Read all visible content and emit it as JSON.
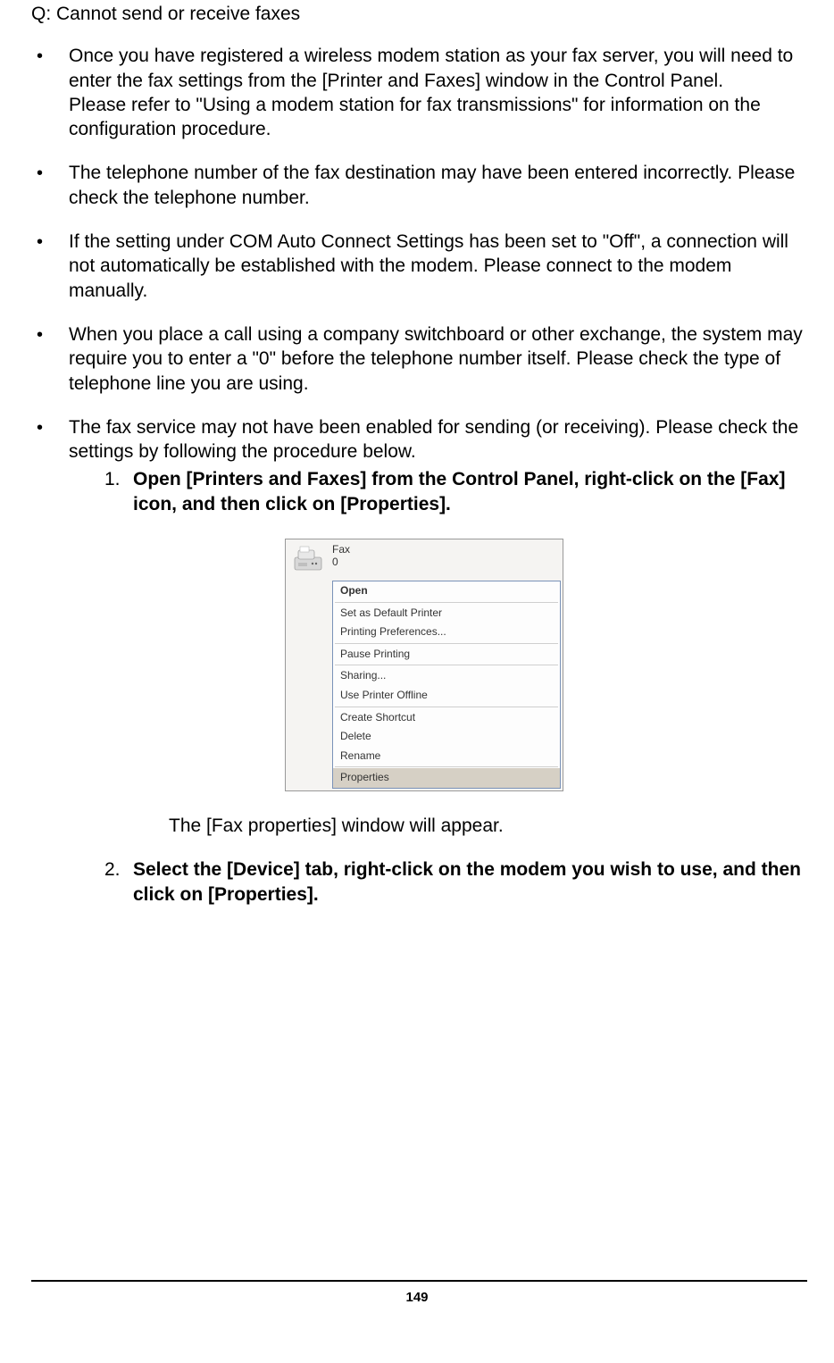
{
  "title": "Q: Cannot send or receive faxes",
  "bullets": [
    {
      "p1": "Once you have registered a wireless modem station as your fax server, you will need to enter the fax settings from the [Printer and Faxes] window in the Control Panel.",
      "p2": "Please refer to \"Using a modem station for fax transmissions\" for information on the configuration procedure."
    },
    {
      "p1": "The telephone number of the fax destination may have been entered incorrectly. Please check the telephone number."
    },
    {
      "p1": "If the setting under COM Auto Connect Settings has been set to \"Off\", a connection will not automatically be established with the modem. Please connect to the modem manually."
    },
    {
      "p1": "When you place a call using a company switchboard or other exchange, the system may require you to enter a \"0\" before the telephone number itself. Please check the type of telephone line you are using."
    },
    {
      "p1": "The fax service may not have been enabled for sending (or receiving). Please check the settings by following the procedure below."
    }
  ],
  "steps": {
    "s1": {
      "num": "1.",
      "text": "Open [Printers and Faxes] from the Control Panel, right-click on the [Fax] icon, and then click on [Properties]."
    },
    "between": "The [Fax properties] window will appear.",
    "s2": {
      "num": "2.",
      "text": "Select the [Device] tab, right-click on the modem you wish to use, and then click on [Properties]."
    }
  },
  "figure": {
    "icon_label_1": "Fax",
    "icon_label_2": "0",
    "menu": {
      "open": "Open",
      "set_default": "Set as Default Printer",
      "prefs": "Printing Preferences...",
      "pause": "Pause Printing",
      "sharing": "Sharing...",
      "offline": "Use Printer Offline",
      "shortcut": "Create Shortcut",
      "delete": "Delete",
      "rename": "Rename",
      "properties": "Properties"
    }
  },
  "page_number": "149"
}
